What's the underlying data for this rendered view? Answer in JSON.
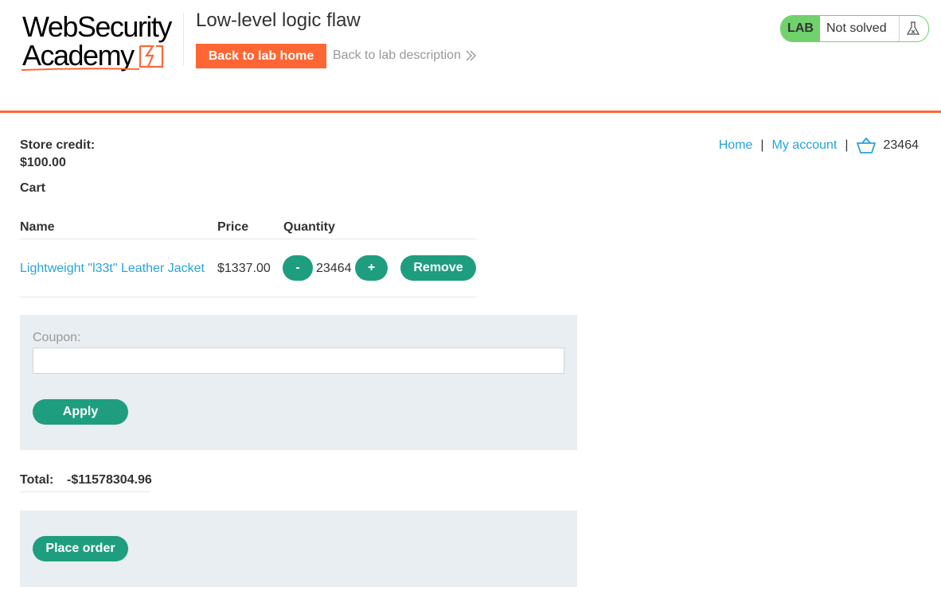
{
  "header": {
    "logo_line1": "WebSecurity",
    "logo_line2": "Academy",
    "lab_title": "Low-level logic flaw",
    "back_home_label": "Back to lab home",
    "back_description_label": "Back to lab description",
    "lab_badge": {
      "tag": "LAB",
      "status": "Not solved"
    }
  },
  "nav": {
    "home_label": "Home",
    "separator": "|",
    "account_label": "My account",
    "cart_count": "23464"
  },
  "store_credit": {
    "label": "Store credit:",
    "value": "$100.00"
  },
  "cart": {
    "heading": "Cart",
    "columns": [
      "Name",
      "Price",
      "Quantity"
    ],
    "items": [
      {
        "name": "Lightweight \"l33t\" Leather Jacket",
        "price": "$1337.00",
        "quantity": "23464",
        "minus_label": "-",
        "plus_label": "+",
        "remove_label": "Remove"
      }
    ]
  },
  "coupon": {
    "label": "Coupon:",
    "value": "",
    "apply_label": "Apply"
  },
  "total": {
    "label": "Total:",
    "value": "-$11578304.96"
  },
  "place_order_label": "Place order",
  "colors": {
    "accent_orange": "#ff6633",
    "button_green": "#1f9e7f",
    "link_blue": "#29a3d6",
    "badge_green": "#70d16d"
  },
  "icons": {
    "cart": "basket-icon",
    "lab_status": "flask-icon",
    "chevron": "double-chevron-right-icon"
  }
}
